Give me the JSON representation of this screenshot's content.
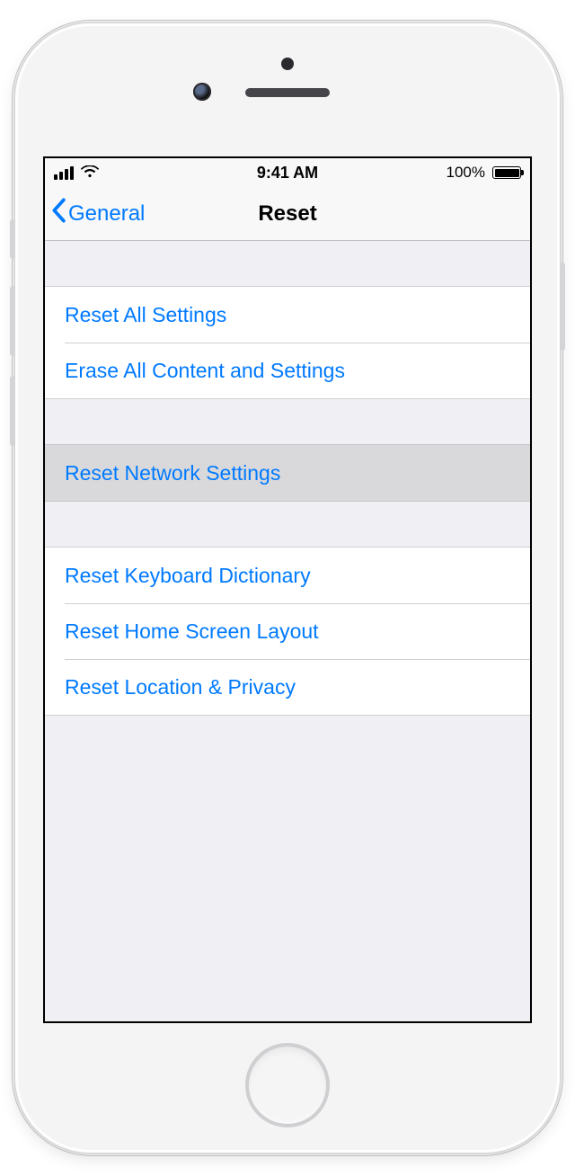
{
  "status": {
    "time": "9:41 AM",
    "battery_pct": "100%"
  },
  "nav": {
    "back_label": "General",
    "title": "Reset"
  },
  "groups": {
    "g1": {
      "reset_all": "Reset All Settings",
      "erase_all": "Erase All Content and Settings"
    },
    "g2": {
      "reset_network": "Reset Network Settings"
    },
    "g3": {
      "reset_keyboard": "Reset Keyboard Dictionary",
      "reset_home": "Reset Home Screen Layout",
      "reset_location": "Reset Location & Privacy"
    }
  }
}
